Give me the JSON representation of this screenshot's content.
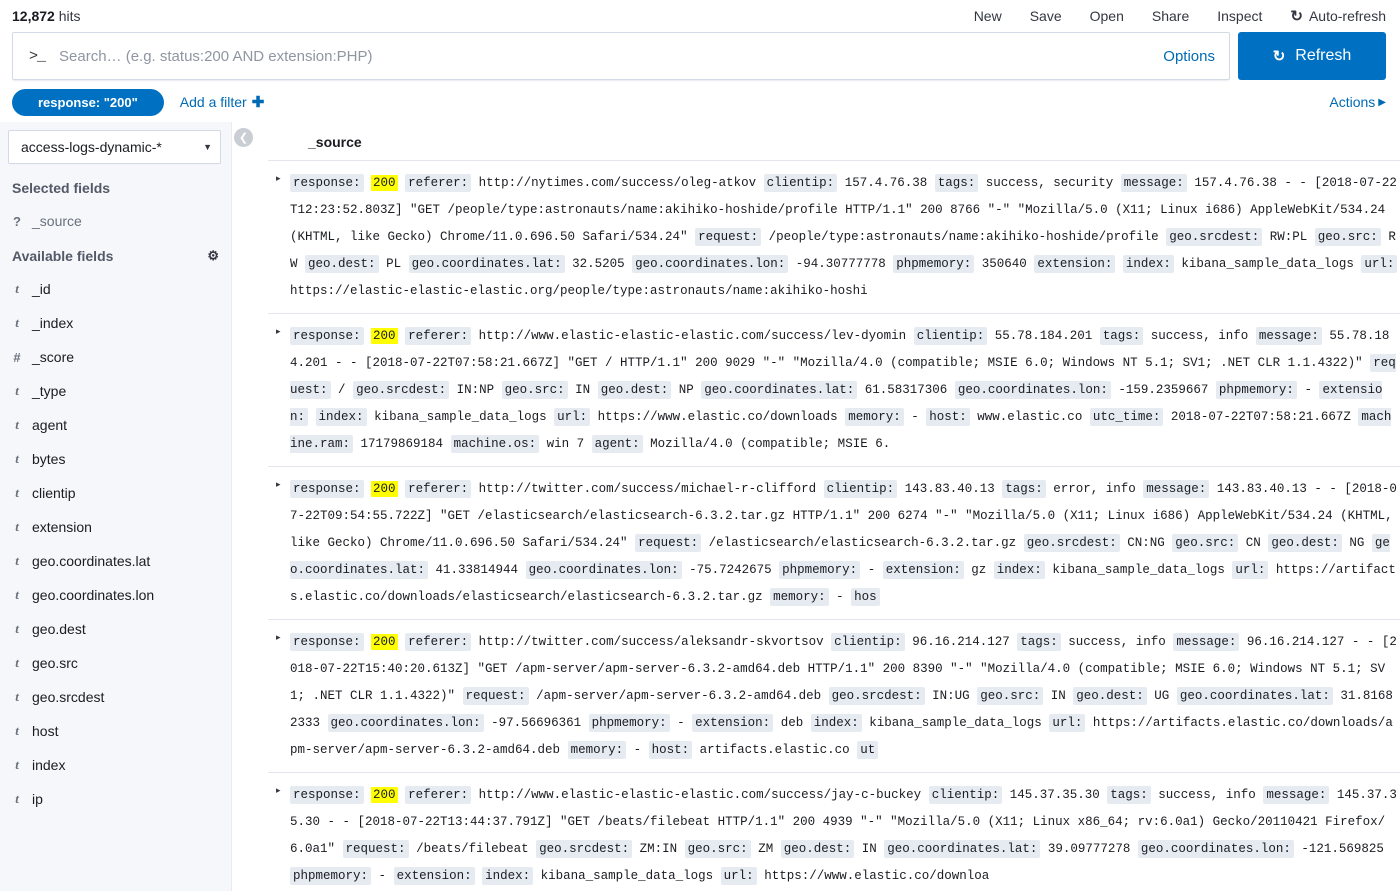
{
  "header": {
    "hits_count": "12,872",
    "hits_label": "hits",
    "nav": [
      {
        "label": "New",
        "icon": ""
      },
      {
        "label": "Save",
        "icon": ""
      },
      {
        "label": "Open",
        "icon": ""
      },
      {
        "label": "Share",
        "icon": ""
      },
      {
        "label": "Inspect",
        "icon": ""
      },
      {
        "label": "Auto-refresh",
        "icon": "refresh-icon"
      }
    ]
  },
  "search": {
    "prompt": ">_",
    "value": "",
    "placeholder": "Search… (e.g. status:200 AND extension:PHP)",
    "options_label": "Options",
    "refresh_label": "Refresh",
    "refresh_icon": "refresh-icon"
  },
  "filters": {
    "pill_label": "response: \"200\"",
    "add_filter_label": "Add a filter",
    "add_filter_plus": "✚",
    "actions_label": "Actions",
    "actions_caret": "▶"
  },
  "sidebar": {
    "index_pattern": "access-logs-dynamic-*",
    "index_caret": "▼",
    "selected_fields_title": "Selected fields",
    "selected_fields": [
      {
        "type": "?",
        "name": "_source"
      }
    ],
    "available_fields_title": "Available fields",
    "settings_icon": "gear-icon",
    "available_fields": [
      {
        "type": "t",
        "name": "_id"
      },
      {
        "type": "t",
        "name": "_index"
      },
      {
        "type": "#",
        "name": "_score"
      },
      {
        "type": "t",
        "name": "_type"
      },
      {
        "type": "t",
        "name": "agent"
      },
      {
        "type": "t",
        "name": "bytes"
      },
      {
        "type": "t",
        "name": "clientip"
      },
      {
        "type": "t",
        "name": "extension"
      },
      {
        "type": "t",
        "name": "geo.coordinates.lat"
      },
      {
        "type": "t",
        "name": "geo.coordinates.lon"
      },
      {
        "type": "t",
        "name": "geo.dest"
      },
      {
        "type": "t",
        "name": "geo.src"
      },
      {
        "type": "t",
        "name": "geo.srcdest"
      },
      {
        "type": "t",
        "name": "host"
      },
      {
        "type": "t",
        "name": "index"
      },
      {
        "type": "t",
        "name": "ip"
      }
    ]
  },
  "collapse_button": {
    "icon": "chevron-left-icon",
    "glyph": "❮"
  },
  "doc_table": {
    "column_header": "_source",
    "expander_glyph": "▸",
    "rows": [
      {
        "tokens": [
          {
            "t": "k",
            "v": "response:"
          },
          {
            "t": "hl",
            "v": "200"
          },
          {
            "t": "k",
            "v": "referer:"
          },
          {
            "t": "v",
            "v": "http://nytimes.com/success/oleg-atkov"
          },
          {
            "t": "k",
            "v": "clientip:"
          },
          {
            "t": "v",
            "v": "157.4.76.38"
          },
          {
            "t": "k",
            "v": "tags:"
          },
          {
            "t": "v",
            "v": "success, security"
          },
          {
            "t": "k",
            "v": "message:"
          },
          {
            "t": "v",
            "v": "157.4.76.38 - - [2018-07-22T12:23:52.803Z] \"GET /people/type:astronauts/name:akihiko-hoshide/profile HTTP/1.1\" 200 8766 \"-\" \"Mozilla/5.0 (X11; Linux i686) AppleWebKit/534.24 (KHTML, like Gecko) Chrome/11.0.696.50 Safari/534.24\""
          },
          {
            "t": "k",
            "v": "request:"
          },
          {
            "t": "v",
            "v": "/people/type:astronauts/name:akihiko-hoshide/profile"
          },
          {
            "t": "k",
            "v": "geo.srcdest:"
          },
          {
            "t": "v",
            "v": "RW:PL"
          },
          {
            "t": "k",
            "v": "geo.src:"
          },
          {
            "t": "v",
            "v": "RW"
          },
          {
            "t": "k",
            "v": "geo.dest:"
          },
          {
            "t": "v",
            "v": "PL"
          },
          {
            "t": "k",
            "v": "geo.coordinates.lat:"
          },
          {
            "t": "v",
            "v": "32.5205"
          },
          {
            "t": "k",
            "v": "geo.coordinates.lon:"
          },
          {
            "t": "v",
            "v": "-94.30777778"
          },
          {
            "t": "k",
            "v": "phpmemory:"
          },
          {
            "t": "v",
            "v": "350640"
          },
          {
            "t": "k",
            "v": "extension:"
          },
          {
            "t": "k",
            "v": "index:"
          },
          {
            "t": "v",
            "v": "kibana_sample_data_logs"
          },
          {
            "t": "k",
            "v": "url:"
          },
          {
            "t": "v",
            "v": "https://elastic-elastic-elastic.org/people/type:astronauts/name:akihiko-hoshi"
          }
        ]
      },
      {
        "tokens": [
          {
            "t": "k",
            "v": "response:"
          },
          {
            "t": "hl",
            "v": "200"
          },
          {
            "t": "k",
            "v": "referer:"
          },
          {
            "t": "v",
            "v": "http://www.elastic-elastic-elastic.com/success/lev-dyomin"
          },
          {
            "t": "k",
            "v": "clientip:"
          },
          {
            "t": "v",
            "v": "55.78.184.201"
          },
          {
            "t": "k",
            "v": "tags:"
          },
          {
            "t": "v",
            "v": "success, info"
          },
          {
            "t": "k",
            "v": "message:"
          },
          {
            "t": "v",
            "v": "55.78.184.201 - - [2018-07-22T07:58:21.667Z] \"GET / HTTP/1.1\" 200 9029 \"-\" \"Mozilla/4.0 (compatible; MSIE 6.0; Windows NT 5.1; SV1; .NET CLR 1.1.4322)\""
          },
          {
            "t": "k",
            "v": "request:"
          },
          {
            "t": "v",
            "v": "/"
          },
          {
            "t": "k",
            "v": "geo.srcdest:"
          },
          {
            "t": "v",
            "v": "IN:NP"
          },
          {
            "t": "k",
            "v": "geo.src:"
          },
          {
            "t": "v",
            "v": "IN"
          },
          {
            "t": "k",
            "v": "geo.dest:"
          },
          {
            "t": "v",
            "v": "NP"
          },
          {
            "t": "k",
            "v": "geo.coordinates.lat:"
          },
          {
            "t": "v",
            "v": "61.58317306"
          },
          {
            "t": "k",
            "v": "geo.coordinates.lon:"
          },
          {
            "t": "v",
            "v": "-159.2359667"
          },
          {
            "t": "k",
            "v": "phpmemory:"
          },
          {
            "t": "v",
            "v": "-"
          },
          {
            "t": "k",
            "v": "extension:"
          },
          {
            "t": "k",
            "v": "index:"
          },
          {
            "t": "v",
            "v": "kibana_sample_data_logs"
          },
          {
            "t": "k",
            "v": "url:"
          },
          {
            "t": "v",
            "v": "https://www.elastic.co/downloads"
          },
          {
            "t": "k",
            "v": "memory:"
          },
          {
            "t": "v",
            "v": "-"
          },
          {
            "t": "k",
            "v": "host:"
          },
          {
            "t": "v",
            "v": "www.elastic.co"
          },
          {
            "t": "k",
            "v": "utc_time:"
          },
          {
            "t": "v",
            "v": "2018-07-22T07:58:21.667Z"
          },
          {
            "t": "k",
            "v": "machine.ram:"
          },
          {
            "t": "v",
            "v": "17179869184"
          },
          {
            "t": "k",
            "v": "machine.os:"
          },
          {
            "t": "v",
            "v": "win 7"
          },
          {
            "t": "k",
            "v": "agent:"
          },
          {
            "t": "v",
            "v": "Mozilla/4.0 (compatible; MSIE 6."
          }
        ]
      },
      {
        "tokens": [
          {
            "t": "k",
            "v": "response:"
          },
          {
            "t": "hl",
            "v": "200"
          },
          {
            "t": "k",
            "v": "referer:"
          },
          {
            "t": "v",
            "v": "http://twitter.com/success/michael-r-clifford"
          },
          {
            "t": "k",
            "v": "clientip:"
          },
          {
            "t": "v",
            "v": "143.83.40.13"
          },
          {
            "t": "k",
            "v": "tags:"
          },
          {
            "t": "v",
            "v": "error, info"
          },
          {
            "t": "k",
            "v": "message:"
          },
          {
            "t": "v",
            "v": "143.83.40.13 - - [2018-07-22T09:54:55.722Z] \"GET /elasticsearch/elasticsearch-6.3.2.tar.gz HTTP/1.1\" 200 6274 \"-\" \"Mozilla/5.0 (X11; Linux i686) AppleWebKit/534.24 (KHTML, like Gecko) Chrome/11.0.696.50 Safari/534.24\""
          },
          {
            "t": "k",
            "v": "request:"
          },
          {
            "t": "v",
            "v": "/elasticsearch/elasticsearch-6.3.2.tar.gz"
          },
          {
            "t": "k",
            "v": "geo.srcdest:"
          },
          {
            "t": "v",
            "v": "CN:NG"
          },
          {
            "t": "k",
            "v": "geo.src:"
          },
          {
            "t": "v",
            "v": "CN"
          },
          {
            "t": "k",
            "v": "geo.dest:"
          },
          {
            "t": "v",
            "v": "NG"
          },
          {
            "t": "k",
            "v": "geo.coordinates.lat:"
          },
          {
            "t": "v",
            "v": "41.33814944"
          },
          {
            "t": "k",
            "v": "geo.coordinates.lon:"
          },
          {
            "t": "v",
            "v": "-75.7242675"
          },
          {
            "t": "k",
            "v": "phpmemory:"
          },
          {
            "t": "v",
            "v": "-"
          },
          {
            "t": "k",
            "v": "extension:"
          },
          {
            "t": "v",
            "v": "gz"
          },
          {
            "t": "k",
            "v": "index:"
          },
          {
            "t": "v",
            "v": "kibana_sample_data_logs"
          },
          {
            "t": "k",
            "v": "url:"
          },
          {
            "t": "v",
            "v": "https://artifacts.elastic.co/downloads/elasticsearch/elasticsearch-6.3.2.tar.gz"
          },
          {
            "t": "k",
            "v": "memory:"
          },
          {
            "t": "v",
            "v": "-"
          },
          {
            "t": "k",
            "v": "hos"
          }
        ]
      },
      {
        "tokens": [
          {
            "t": "k",
            "v": "response:"
          },
          {
            "t": "hl",
            "v": "200"
          },
          {
            "t": "k",
            "v": "referer:"
          },
          {
            "t": "v",
            "v": "http://twitter.com/success/aleksandr-skvortsov"
          },
          {
            "t": "k",
            "v": "clientip:"
          },
          {
            "t": "v",
            "v": "96.16.214.127"
          },
          {
            "t": "k",
            "v": "tags:"
          },
          {
            "t": "v",
            "v": "success, info"
          },
          {
            "t": "k",
            "v": "message:"
          },
          {
            "t": "v",
            "v": "96.16.214.127 - - [2018-07-22T15:40:20.613Z] \"GET /apm-server/apm-server-6.3.2-amd64.deb HTTP/1.1\" 200 8390 \"-\" \"Mozilla/4.0 (compatible; MSIE 6.0; Windows NT 5.1; SV1; .NET CLR 1.1.4322)\""
          },
          {
            "t": "k",
            "v": "request:"
          },
          {
            "t": "v",
            "v": "/apm-server/apm-server-6.3.2-amd64.deb"
          },
          {
            "t": "k",
            "v": "geo.srcdest:"
          },
          {
            "t": "v",
            "v": "IN:UG"
          },
          {
            "t": "k",
            "v": "geo.src:"
          },
          {
            "t": "v",
            "v": "IN"
          },
          {
            "t": "k",
            "v": "geo.dest:"
          },
          {
            "t": "v",
            "v": "UG"
          },
          {
            "t": "k",
            "v": "geo.coordinates.lat:"
          },
          {
            "t": "v",
            "v": "31.81682333"
          },
          {
            "t": "k",
            "v": "geo.coordinates.lon:"
          },
          {
            "t": "v",
            "v": "-97.56696361"
          },
          {
            "t": "k",
            "v": "phpmemory:"
          },
          {
            "t": "v",
            "v": "-"
          },
          {
            "t": "k",
            "v": "extension:"
          },
          {
            "t": "v",
            "v": "deb"
          },
          {
            "t": "k",
            "v": "index:"
          },
          {
            "t": "v",
            "v": "kibana_sample_data_logs"
          },
          {
            "t": "k",
            "v": "url:"
          },
          {
            "t": "v",
            "v": "https://artifacts.elastic.co/downloads/apm-server/apm-server-6.3.2-amd64.deb"
          },
          {
            "t": "k",
            "v": "memory:"
          },
          {
            "t": "v",
            "v": "-"
          },
          {
            "t": "k",
            "v": "host:"
          },
          {
            "t": "v",
            "v": "artifacts.elastic.co"
          },
          {
            "t": "k",
            "v": "ut"
          }
        ]
      },
      {
        "tokens": [
          {
            "t": "k",
            "v": "response:"
          },
          {
            "t": "hl",
            "v": "200"
          },
          {
            "t": "k",
            "v": "referer:"
          },
          {
            "t": "v",
            "v": "http://www.elastic-elastic-elastic.com/success/jay-c-buckey"
          },
          {
            "t": "k",
            "v": "clientip:"
          },
          {
            "t": "v",
            "v": "145.37.35.30"
          },
          {
            "t": "k",
            "v": "tags:"
          },
          {
            "t": "v",
            "v": "success, info"
          },
          {
            "t": "k",
            "v": "message:"
          },
          {
            "t": "v",
            "v": "145.37.35.30 - - [2018-07-22T13:44:37.791Z] \"GET /beats/filebeat HTTP/1.1\" 200 4939 \"-\" \"Mozilla/5.0 (X11; Linux x86_64; rv:6.0a1) Gecko/20110421 Firefox/6.0a1\""
          },
          {
            "t": "k",
            "v": "request:"
          },
          {
            "t": "v",
            "v": "/beats/filebeat"
          },
          {
            "t": "k",
            "v": "geo.srcdest:"
          },
          {
            "t": "v",
            "v": "ZM:IN"
          },
          {
            "t": "k",
            "v": "geo.src:"
          },
          {
            "t": "v",
            "v": "ZM"
          },
          {
            "t": "k",
            "v": "geo.dest:"
          },
          {
            "t": "v",
            "v": "IN"
          },
          {
            "t": "k",
            "v": "geo.coordinates.lat:"
          },
          {
            "t": "v",
            "v": "39.09777278"
          },
          {
            "t": "k",
            "v": "geo.coordinates.lon:"
          },
          {
            "t": "v",
            "v": "-121.569825"
          },
          {
            "t": "k",
            "v": "phpmemory:"
          },
          {
            "t": "v",
            "v": "-"
          },
          {
            "t": "k",
            "v": "extension:"
          },
          {
            "t": "k",
            "v": "index:"
          },
          {
            "t": "v",
            "v": "kibana_sample_data_logs"
          },
          {
            "t": "k",
            "v": "url:"
          },
          {
            "t": "v",
            "v": "https://www.elastic.co/downloa"
          }
        ]
      }
    ]
  }
}
